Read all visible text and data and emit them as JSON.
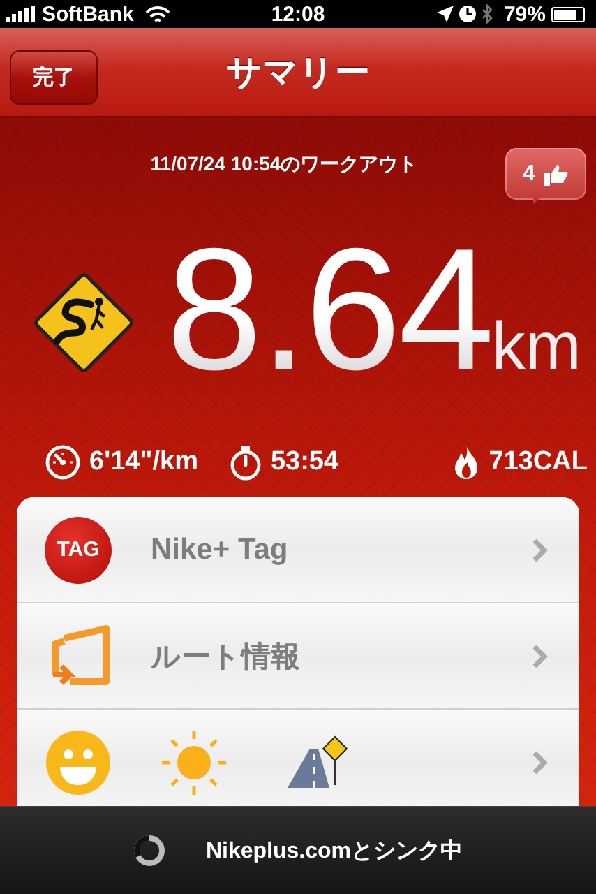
{
  "status_bar": {
    "carrier": "SoftBank",
    "time": "12:08",
    "battery": "79%"
  },
  "nav_bar": {
    "title": "サマリー",
    "done_button": "完了"
  },
  "workout": {
    "label": "11/07/24 10:54のワークアウト",
    "likes": "4",
    "distance": "8.64",
    "unit": "km"
  },
  "stats": [
    {
      "kind": "pace",
      "value": "6'14\"/km"
    },
    {
      "kind": "time",
      "value": "53:54"
    },
    {
      "kind": "calories",
      "value": "713CAL"
    }
  ],
  "menu": [
    {
      "kind": "tag",
      "label": "Nike+ Tag",
      "badge": "TAG"
    },
    {
      "kind": "route",
      "label": "ルート情報"
    },
    {
      "kind": "conditions"
    }
  ],
  "sync_bar": {
    "message": "Nikeplus.comとシンク中"
  }
}
